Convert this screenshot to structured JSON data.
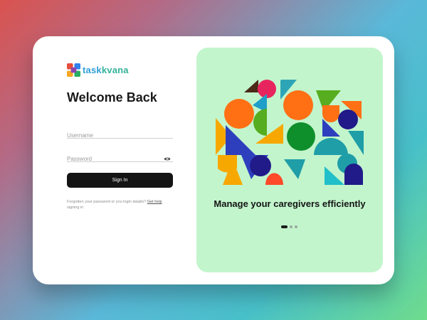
{
  "brand": {
    "name_part1": "task",
    "name_part2": "kvana"
  },
  "login": {
    "title": "Welcome Back",
    "username_placeholder": "Username",
    "username_value": "",
    "password_placeholder": "Password",
    "password_value": "",
    "signin_label": "Sign In",
    "help_text": "Forgotten your password or you login datails? ",
    "help_link": "Get help",
    "help_suffix": " signing in"
  },
  "promo": {
    "tagline": "Manage your caregivers efficiently",
    "slides_total": 3,
    "active_slide": 1
  },
  "colors": {
    "background_start": "#d9534f",
    "background_end": "#6fdc8c",
    "button": "#141414",
    "promo_panel": "#c2f5cc",
    "brand_text": "#2f9fd8"
  },
  "icons": {
    "logo": "taskvana-logo-icon",
    "password_toggle": "eye-icon"
  }
}
